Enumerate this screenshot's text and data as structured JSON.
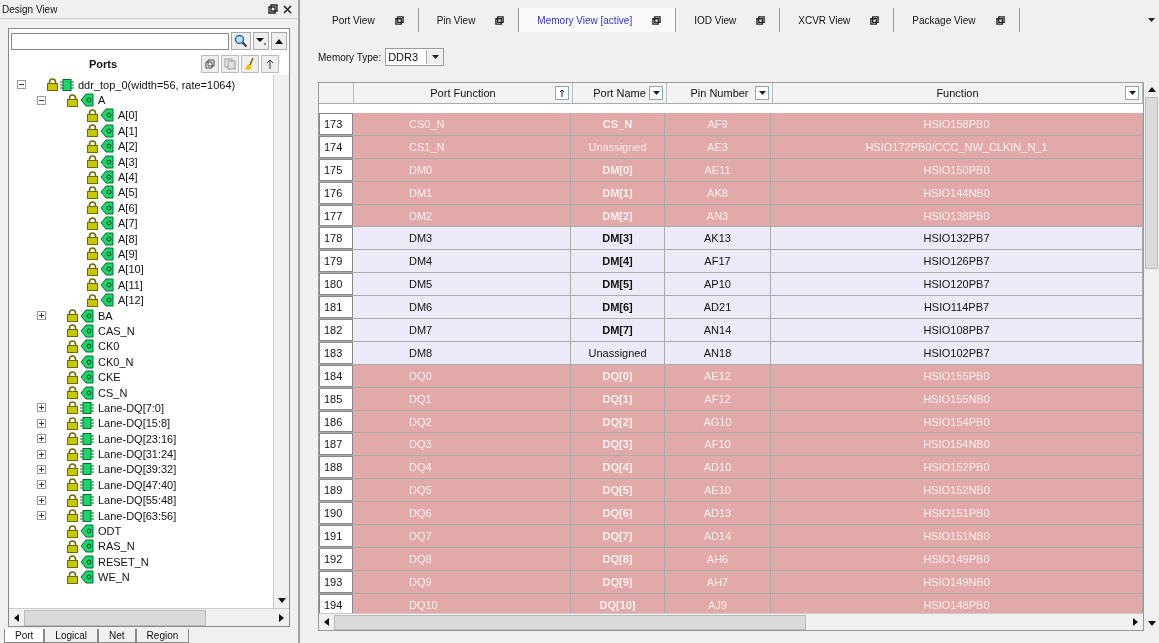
{
  "design_view": {
    "title": "Design View",
    "ports_header": "Ports",
    "tree": [
      {
        "label": "ddr_top_0(width=56, rate=1064)",
        "kind": "group",
        "expanded": true,
        "children": [
          {
            "label": "A",
            "kind": "port",
            "expanded": true,
            "children": [
              {
                "label": "A[0]",
                "kind": "port"
              },
              {
                "label": "A[1]",
                "kind": "port"
              },
              {
                "label": "A[2]",
                "kind": "port"
              },
              {
                "label": "A[3]",
                "kind": "port"
              },
              {
                "label": "A[4]",
                "kind": "port"
              },
              {
                "label": "A[5]",
                "kind": "port"
              },
              {
                "label": "A[6]",
                "kind": "port"
              },
              {
                "label": "A[7]",
                "kind": "port"
              },
              {
                "label": "A[8]",
                "kind": "port"
              },
              {
                "label": "A[9]",
                "kind": "port"
              },
              {
                "label": "A[10]",
                "kind": "port"
              },
              {
                "label": "A[11]",
                "kind": "port"
              },
              {
                "label": "A[12]",
                "kind": "port"
              }
            ]
          },
          {
            "label": "BA",
            "kind": "port",
            "expanded": false
          },
          {
            "label": "CAS_N",
            "kind": "port"
          },
          {
            "label": "CK0",
            "kind": "port"
          },
          {
            "label": "CK0_N",
            "kind": "port"
          },
          {
            "label": "CKE",
            "kind": "port"
          },
          {
            "label": "CS_N",
            "kind": "port"
          },
          {
            "label": "Lane-DQ[7:0]",
            "kind": "group",
            "expanded": false
          },
          {
            "label": "Lane-DQ[15:8]",
            "kind": "group",
            "expanded": false
          },
          {
            "label": "Lane-DQ[23:16]",
            "kind": "group",
            "expanded": false
          },
          {
            "label": "Lane-DQ[31:24]",
            "kind": "group",
            "expanded": false
          },
          {
            "label": "Lane-DQ[39:32]",
            "kind": "group",
            "expanded": false
          },
          {
            "label": "Lane-DQ[47:40]",
            "kind": "group",
            "expanded": false
          },
          {
            "label": "Lane-DQ[55:48]",
            "kind": "group",
            "expanded": false
          },
          {
            "label": "Lane-DQ[63:56]",
            "kind": "group",
            "expanded": false
          },
          {
            "label": "ODT",
            "kind": "port"
          },
          {
            "label": "RAS_N",
            "kind": "port"
          },
          {
            "label": "RESET_N",
            "kind": "port"
          },
          {
            "label": "WE_N",
            "kind": "port"
          }
        ]
      }
    ],
    "bottom_tabs": [
      {
        "label": "Port",
        "selected": true
      },
      {
        "label": "Logical",
        "selected": false
      },
      {
        "label": "Net",
        "selected": false
      },
      {
        "label": "Region",
        "selected": false
      }
    ]
  },
  "tabs": [
    {
      "label": "Port View",
      "selected": false
    },
    {
      "label": "Pin View",
      "selected": false
    },
    {
      "label": "Memory View [active]",
      "selected": true
    },
    {
      "label": "IOD View",
      "selected": false
    },
    {
      "label": "XCVR View",
      "selected": false
    },
    {
      "label": "Package View",
      "selected": false
    }
  ],
  "memory_type": {
    "label": "Memory Type:",
    "value": "DDR3"
  },
  "table": {
    "columns": [
      "Port Function",
      "Port Name",
      "Pin Number",
      "Function"
    ],
    "rows": [
      {
        "number": "173",
        "port_function": "CS0_N",
        "port_name": "CS_N",
        "pin_number": "AF9",
        "function": "HSIO158PB0",
        "conflict": true,
        "assigned": true
      },
      {
        "number": "174",
        "port_function": "CS1_N",
        "port_name": "Unassigned",
        "pin_number": "AE3",
        "function": "HSIO172PB0/CCC_NW_CLKIN_N_1",
        "conflict": true,
        "assigned": false
      },
      {
        "number": "175",
        "port_function": "DM0",
        "port_name": "DM[0]",
        "pin_number": "AE11",
        "function": "HSIO150PB0",
        "conflict": true,
        "assigned": true
      },
      {
        "number": "176",
        "port_function": "DM1",
        "port_name": "DM[1]",
        "pin_number": "AK8",
        "function": "HSIO144NB0",
        "conflict": true,
        "assigned": true
      },
      {
        "number": "177",
        "port_function": "DM2",
        "port_name": "DM[2]",
        "pin_number": "AN3",
        "function": "HSIO138PB0",
        "conflict": true,
        "assigned": true
      },
      {
        "number": "178",
        "port_function": "DM3",
        "port_name": "DM[3]",
        "pin_number": "AK13",
        "function": "HSIO132PB7",
        "conflict": false,
        "assigned": true
      },
      {
        "number": "179",
        "port_function": "DM4",
        "port_name": "DM[4]",
        "pin_number": "AF17",
        "function": "HSIO126PB7",
        "conflict": false,
        "assigned": true
      },
      {
        "number": "180",
        "port_function": "DM5",
        "port_name": "DM[5]",
        "pin_number": "AP10",
        "function": "HSIO120PB7",
        "conflict": false,
        "assigned": true
      },
      {
        "number": "181",
        "port_function": "DM6",
        "port_name": "DM[6]",
        "pin_number": "AD21",
        "function": "HSIO114PB7",
        "conflict": false,
        "assigned": true
      },
      {
        "number": "182",
        "port_function": "DM7",
        "port_name": "DM[7]",
        "pin_number": "AN14",
        "function": "HSIO108PB7",
        "conflict": false,
        "assigned": true
      },
      {
        "number": "183",
        "port_function": "DM8",
        "port_name": "Unassigned",
        "pin_number": "AN18",
        "function": "HSIO102PB7",
        "conflict": false,
        "assigned": false
      },
      {
        "number": "184",
        "port_function": "DQ0",
        "port_name": "DQ[0]",
        "pin_number": "AE12",
        "function": "HSIO155PB0",
        "conflict": true,
        "assigned": true
      },
      {
        "number": "185",
        "port_function": "DQ1",
        "port_name": "DQ[1]",
        "pin_number": "AF12",
        "function": "HSIO155NB0",
        "conflict": true,
        "assigned": true
      },
      {
        "number": "186",
        "port_function": "DQ2",
        "port_name": "DQ[2]",
        "pin_number": "AG10",
        "function": "HSIO154PB0",
        "conflict": true,
        "assigned": true
      },
      {
        "number": "187",
        "port_function": "DQ3",
        "port_name": "DQ[3]",
        "pin_number": "AF10",
        "function": "HSIO154NB0",
        "conflict": true,
        "assigned": true
      },
      {
        "number": "188",
        "port_function": "DQ4",
        "port_name": "DQ[4]",
        "pin_number": "AD10",
        "function": "HSIO152PB0",
        "conflict": true,
        "assigned": true
      },
      {
        "number": "189",
        "port_function": "DQ5",
        "port_name": "DQ[5]",
        "pin_number": "AE10",
        "function": "HSIO152NB0",
        "conflict": true,
        "assigned": true
      },
      {
        "number": "190",
        "port_function": "DQ6",
        "port_name": "DQ[6]",
        "pin_number": "AD13",
        "function": "HSIO151PB0",
        "conflict": true,
        "assigned": true
      },
      {
        "number": "191",
        "port_function": "DQ7",
        "port_name": "DQ[7]",
        "pin_number": "AD14",
        "function": "HSIO151NB0",
        "conflict": true,
        "assigned": true
      },
      {
        "number": "192",
        "port_function": "DQ8",
        "port_name": "DQ[8]",
        "pin_number": "AH6",
        "function": "HSIO149PB0",
        "conflict": true,
        "assigned": true
      },
      {
        "number": "193",
        "port_function": "DQ9",
        "port_name": "DQ[9]",
        "pin_number": "AH7",
        "function": "HSIO149NB0",
        "conflict": true,
        "assigned": true
      },
      {
        "number": "194",
        "port_function": "DQ10",
        "port_name": "DQ[10]",
        "pin_number": "AJ9",
        "function": "HSIO148PB0",
        "conflict": true,
        "assigned": true
      }
    ]
  }
}
